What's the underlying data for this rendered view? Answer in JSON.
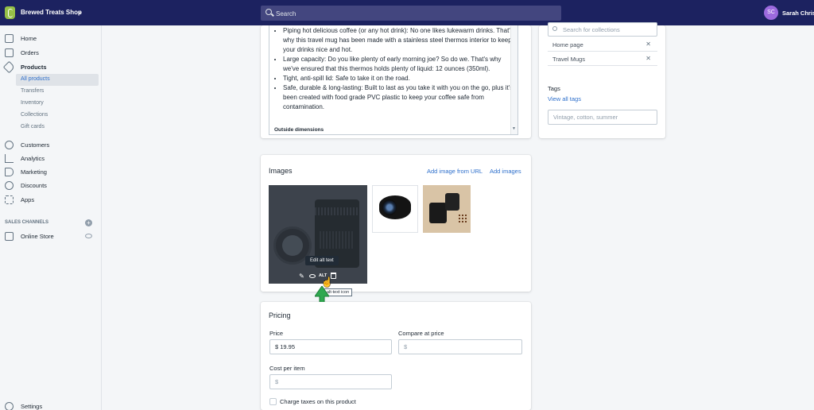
{
  "topbar": {
    "shop_name": "Brewed Treats Shop",
    "search_placeholder": "Search",
    "user_initials": "SC",
    "user_name": "Sarah Chrisp"
  },
  "sidebar": {
    "items": [
      {
        "label": "Home",
        "icon": "home-icon"
      },
      {
        "label": "Orders",
        "icon": "orders-icon"
      },
      {
        "label": "Products",
        "icon": "tag-icon"
      }
    ],
    "product_sub": [
      "All products",
      "Transfers",
      "Inventory",
      "Collections",
      "Gift cards"
    ],
    "items2": [
      {
        "label": "Customers",
        "icon": "person-icon"
      },
      {
        "label": "Analytics",
        "icon": "chart-icon"
      },
      {
        "label": "Marketing",
        "icon": "megaphone-icon"
      },
      {
        "label": "Discounts",
        "icon": "discount-icon"
      },
      {
        "label": "Apps",
        "icon": "apps-icon"
      }
    ],
    "channels_title": "SALES CHANNELS",
    "online_store": "Online Store",
    "settings": "Settings"
  },
  "description": {
    "bullets": [
      "Piping hot delicious coffee (or any hot drink): No one likes lukewarm drinks. That's why this travel mug has been made with a stainless steel thermos interior to keep your drinks nice and hot.",
      "Large capacity: Do you like plenty of early morning joe? So do we. That's why we've ensured that this thermos holds plenty of liquid: 12 ounces (350ml).",
      "Tight, anti-spill lid: Safe to take it on the road.",
      "Safe, durable & long-lasting: Built to last as you take it with you on the go, plus it's been created with food grade PVC plastic to keep your coffee safe from contamination."
    ],
    "outside": "Outside dimensions"
  },
  "images": {
    "title": "Images",
    "add_url": "Add image from URL",
    "add_images": "Add images",
    "tooltip": "Edit alt text",
    "alt_label": "ALT",
    "cursor_tip": "alt-text icon"
  },
  "pricing": {
    "title": "Pricing",
    "price_label": "Price",
    "price_value": "$ 19.95",
    "compare_label": "Compare at price",
    "compare_ph": "$",
    "cost_label": "Cost per item",
    "cost_ph": "$",
    "taxes_label": "Charge taxes on this product"
  },
  "organization": {
    "collections_placeholder": "Search for collections",
    "collections": [
      "Home page",
      "Travel Mugs"
    ],
    "tags_title": "Tags",
    "tags_link": "View all tags",
    "tags_placeholder": "Vintage, cotton, summer"
  },
  "colors": {
    "topbar": "#1c2260",
    "link": "#2c6ecb",
    "highlight_arrow": "#2fa84f"
  }
}
